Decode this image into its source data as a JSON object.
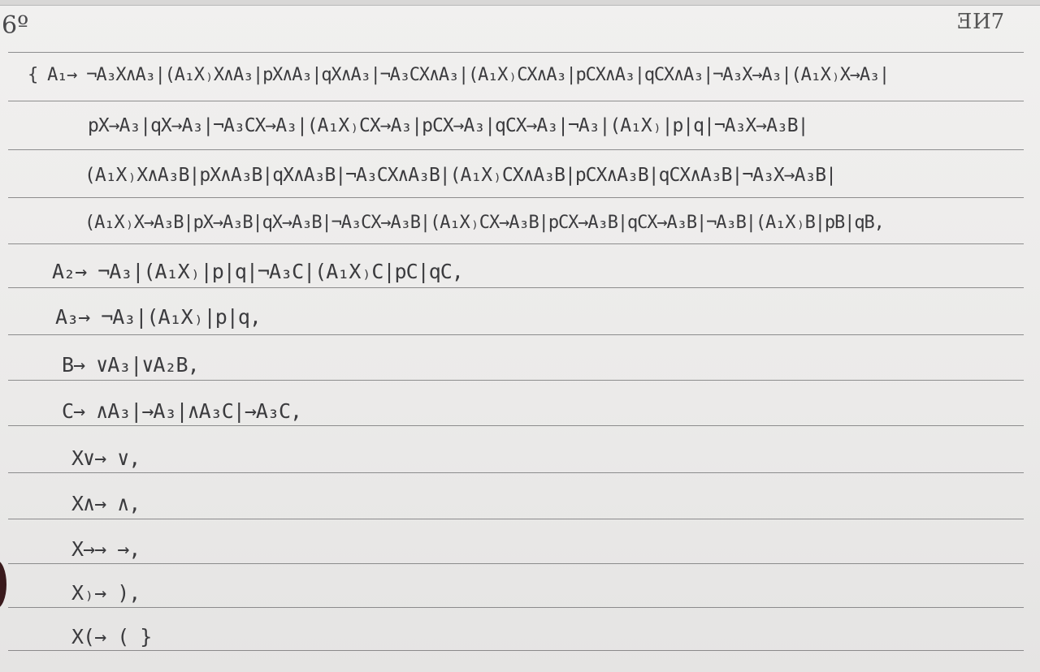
{
  "page": {
    "page_number": "6º",
    "corner_mark": "ƎИ7"
  },
  "grammar": {
    "rules": [
      "{ A₁→ ¬A₃X∧A₃|(A₁X₎X∧A₃|pX∧A₃|qX∧A₃|¬A₃CX∧A₃|(A₁X₎CX∧A₃|pCX∧A₃|qCX∧A₃|¬A₃X→A₃|(A₁X₎X→A₃|",
      "pX→A₃|qX→A₃|¬A₃CX→A₃|(A₁X₎CX→A₃|pCX→A₃|qCX→A₃|¬A₃|(A₁X₎|p|q|¬A₃X→A₃B|",
      "(A₁X₎X∧A₃B|pX∧A₃B|qX∧A₃B|¬A₃CX∧A₃B|(A₁X₎CX∧A₃B|pCX∧A₃B|qCX∧A₃B|¬A₃X→A₃B|",
      "(A₁X₎X→A₃B|pX→A₃B|qX→A₃B|¬A₃CX→A₃B|(A₁X₎CX→A₃B|pCX→A₃B|qCX→A₃B|¬A₃B|(A₁X₎B|pB|qB,",
      "A₂→ ¬A₃|(A₁X₎|p|q|¬A₃C|(A₁X₎C|pC|qC,",
      "A₃→ ¬A₃|(A₁X₎|p|q,",
      "B→ ∨A₃|∨A₂B,",
      "C→ ∧A₃|→A₃|∧A₃C|→A₃C,",
      "X∨→ ∨,",
      "X∧→ ∧,",
      "X→→ →,",
      "X₎→ ),",
      "X(→ ( }"
    ]
  }
}
